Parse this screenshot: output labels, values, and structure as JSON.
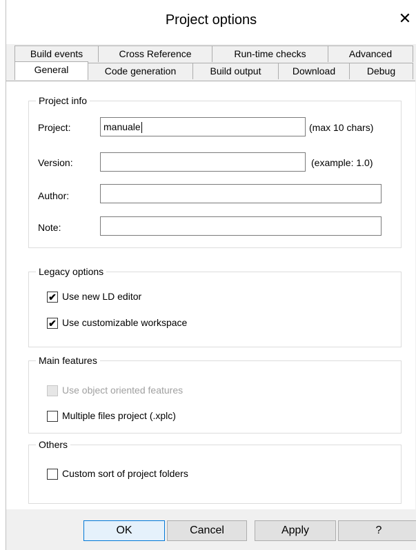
{
  "window": {
    "title": "Project options",
    "close_glyph": "✕"
  },
  "tabs": {
    "row1": [
      "Build events",
      "Cross Reference",
      "Run-time checks",
      "Advanced"
    ],
    "row2": [
      "General",
      "Code generation",
      "Build output",
      "Download",
      "Debug"
    ],
    "active": "General"
  },
  "project_info": {
    "legend": "Project info",
    "project_label": "Project:",
    "project_value": "manuale",
    "project_hint": "(max 10 chars)",
    "version_label": "Version:",
    "version_value": "",
    "version_hint": "(example: 1.0)",
    "author_label": "Author:",
    "author_value": "",
    "note_label": "Note:",
    "note_value": ""
  },
  "legacy": {
    "legend": "Legacy options",
    "ld_editor_label": "Use new LD editor",
    "ld_editor_checked": true,
    "workspace_label": "Use customizable workspace",
    "workspace_checked": true
  },
  "main_features": {
    "legend": "Main features",
    "oo_label": "Use object oriented features",
    "oo_checked": false,
    "oo_enabled": false,
    "multi_label": "Multiple files project (.xplc)",
    "multi_checked": false
  },
  "others": {
    "legend": "Others",
    "sort_label": "Custom sort of project folders",
    "sort_checked": false
  },
  "footer": {
    "ok": "OK",
    "cancel": "Cancel",
    "apply": "Apply",
    "help": "?"
  },
  "check_glyph": "✔"
}
